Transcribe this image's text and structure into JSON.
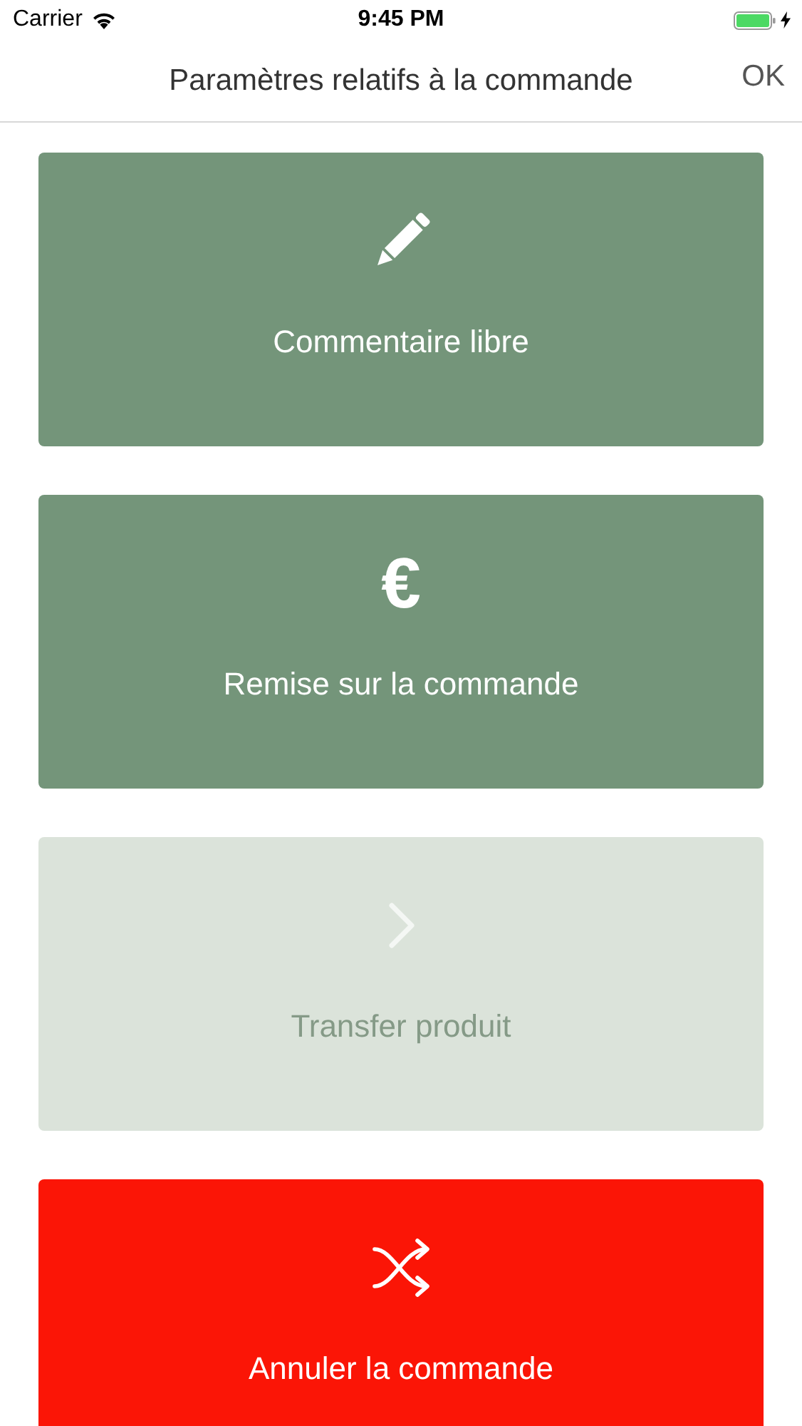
{
  "status_bar": {
    "carrier": "Carrier",
    "time": "9:45 PM",
    "charging": true
  },
  "nav_bar": {
    "title": "Paramètres relatifs à la commande",
    "done": "OK"
  },
  "actions": [
    {
      "kind": "pencil",
      "label": "Commentaire libre",
      "disabled": false,
      "color": "#74957a"
    },
    {
      "kind": "symbol",
      "symbol": "€",
      "label": "Remise sur la commande",
      "disabled": false,
      "color": "#74957a"
    },
    {
      "kind": "chevron",
      "label": "Transfer produit",
      "disabled": true,
      "color": "#dbe3da"
    },
    {
      "kind": "shuffle",
      "label": "Annuler la commande",
      "disabled": false,
      "color": "#fb1506"
    }
  ]
}
